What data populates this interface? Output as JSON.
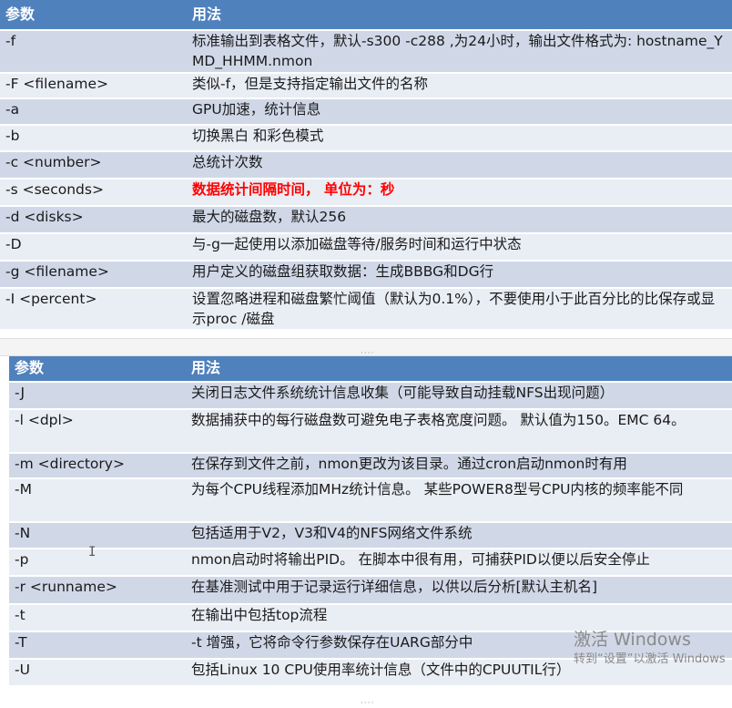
{
  "table1": {
    "headers": [
      "参数",
      "用法"
    ],
    "rows": [
      {
        "param": "-f",
        "usage": "标准输出到表格文件，默认-s300 -c288 ,为24小时，输出文件格式为: hostname_YMD_HHMM.nmon"
      },
      {
        "param": "-F <filename>",
        "usage": "类似-f，但是支持指定输出文件的名称"
      },
      {
        "param": "-a",
        "usage": "GPU加速，统计信息"
      },
      {
        "param": "-b",
        "usage": "切换黑白 和彩色模式"
      },
      {
        "param": "-c <number>",
        "usage": "总统计次数"
      },
      {
        "param": "-s <seconds>",
        "usage": "数据统计间隔时间， 单位为：秒"
      },
      {
        "param": "-d <disks>",
        "usage": "最大的磁盘数，默认256"
      },
      {
        "param": "-D",
        "usage": "与-g一起使用以添加磁盘等待/服务时间和运行中状态"
      },
      {
        "param": "-g <filename>",
        "usage": "用户定义的磁盘组获取数据：生成BBBG和DG行"
      },
      {
        "param": "-I <percent>",
        "usage": "设置忽略进程和磁盘繁忙阈值（默认为0.1%），不要使用小于此百分比的比保存或显示proc /磁盘"
      }
    ]
  },
  "table2": {
    "headers": [
      "参数",
      "用法"
    ],
    "rows": [
      {
        "param": "-J",
        "usage": "关闭日志文件系统统计信息收集（可能导致自动挂载NFS出现问题）"
      },
      {
        "param": "-l <dpl>",
        "usage": "数据捕获中的每行磁盘数可避免电子表格宽度问题。 默认值为150。EMC 64。"
      },
      {
        "param": "-m <directory>",
        "usage": "在保存到文件之前，nmon更改为该目录。通过cron启动nmon时有用"
      },
      {
        "param": "-M",
        "usage": "为每个CPU线程添加MHz统计信息。 某些POWER8型号CPU内核的频率能不同"
      },
      {
        "param": "-N",
        "usage": "包括适用于V2，V3和V4的NFS网络文件系统"
      },
      {
        "param": "-p",
        "usage": "nmon启动时将输出PID。 在脚本中很有用，可捕获PID以便以后安全停止"
      },
      {
        "param": "-r <runname>",
        "usage": "在基准测试中用于记录运行详细信息，以供以后分析[默认主机名]"
      },
      {
        "param": "-t",
        "usage": "在输出中包括top流程"
      },
      {
        "param": "-T",
        "usage": "-t 增强，它将命令行参数保存在UARG部分中"
      },
      {
        "param": "-U",
        "usage": "包括Linux 10 CPU使用率统计信息（文件中的CPUUTIL行）"
      }
    ]
  },
  "watermark": {
    "line1": "激活 Windows",
    "line2": "转到“设置”以激活 Windows"
  },
  "colors": {
    "header_bg": "#4f81bd",
    "row_odd": "#d0d8e8",
    "row_even": "#e9edf4",
    "highlight_text": "#ff0000"
  }
}
